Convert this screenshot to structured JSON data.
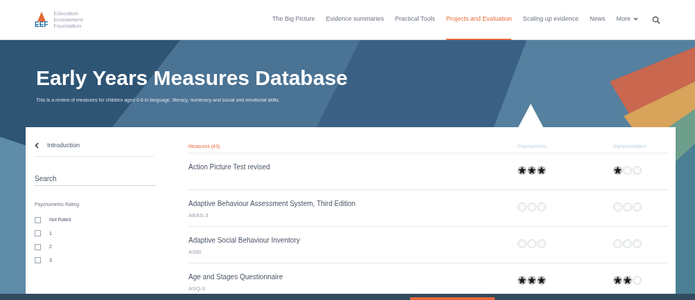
{
  "logo": {
    "mark": "EEF",
    "lines": [
      "Education",
      "Endowment",
      "Foundation"
    ]
  },
  "nav": [
    {
      "label": "The Big Picture",
      "selected": false
    },
    {
      "label": "Evidence summaries",
      "selected": false
    },
    {
      "label": "Practical Tools",
      "selected": false
    },
    {
      "label": "Projects and Evaluation",
      "selected": true
    },
    {
      "label": "Scaling up evidence",
      "selected": false
    },
    {
      "label": "News",
      "selected": false
    },
    {
      "label": "More",
      "selected": false
    }
  ],
  "hero": {
    "title": "Early Years Measures Database",
    "subtitle": "This is a review of measures for children aged 0-6 in language, literacy, numeracy and social and emotional skills."
  },
  "sidebar": {
    "back": "Introduction",
    "search": {
      "placeholder": "Search"
    },
    "filter_title": "Psychometric Rating",
    "options": [
      {
        "label": "Not Rated",
        "checked": false
      },
      {
        "label": "1",
        "checked": false
      },
      {
        "label": "2",
        "checked": false
      },
      {
        "label": "3",
        "checked": false
      }
    ]
  },
  "table": {
    "columns": [
      "Measures (49)",
      "Psychometric",
      "Implementation"
    ],
    "rows": [
      {
        "name": "Action Picture Test revised",
        "psychometric": {
          "stars": 3
        },
        "implementation": {
          "stars": 1
        }
      },
      {
        "name": "Adaptive Behaviour Assessment System, Third Edition",
        "abbr": "ABAS-3",
        "psychometric": {
          "stars": 0
        },
        "implementation": {
          "stars": 0
        }
      },
      {
        "name": "Adaptive Social Behaviour Inventory",
        "abbr": "ASBI",
        "psychometric": {
          "stars": 0
        },
        "implementation": {
          "stars": 0
        }
      },
      {
        "name": "Age and Stages Questionnaire",
        "abbr": "ASQ-3",
        "psychometric": {
          "stars": 3
        },
        "implementation": {
          "stars": 2
        }
      }
    ]
  }
}
